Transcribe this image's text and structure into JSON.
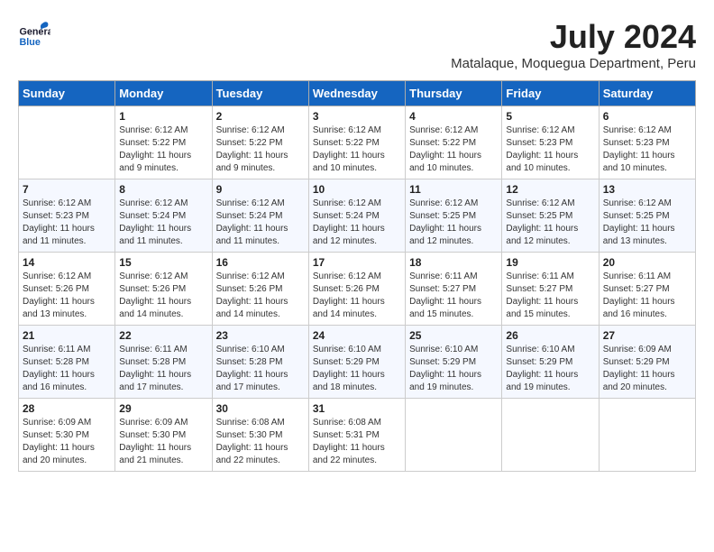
{
  "header": {
    "logo_general": "General",
    "logo_blue": "Blue",
    "month_year": "July 2024",
    "location": "Matalaque, Moquegua Department, Peru"
  },
  "weekdays": [
    "Sunday",
    "Monday",
    "Tuesday",
    "Wednesday",
    "Thursday",
    "Friday",
    "Saturday"
  ],
  "weeks": [
    [
      {
        "day": "",
        "info": ""
      },
      {
        "day": "1",
        "info": "Sunrise: 6:12 AM\nSunset: 5:22 PM\nDaylight: 11 hours\nand 9 minutes."
      },
      {
        "day": "2",
        "info": "Sunrise: 6:12 AM\nSunset: 5:22 PM\nDaylight: 11 hours\nand 9 minutes."
      },
      {
        "day": "3",
        "info": "Sunrise: 6:12 AM\nSunset: 5:22 PM\nDaylight: 11 hours\nand 10 minutes."
      },
      {
        "day": "4",
        "info": "Sunrise: 6:12 AM\nSunset: 5:22 PM\nDaylight: 11 hours\nand 10 minutes."
      },
      {
        "day": "5",
        "info": "Sunrise: 6:12 AM\nSunset: 5:23 PM\nDaylight: 11 hours\nand 10 minutes."
      },
      {
        "day": "6",
        "info": "Sunrise: 6:12 AM\nSunset: 5:23 PM\nDaylight: 11 hours\nand 10 minutes."
      }
    ],
    [
      {
        "day": "7",
        "info": "Sunrise: 6:12 AM\nSunset: 5:23 PM\nDaylight: 11 hours\nand 11 minutes."
      },
      {
        "day": "8",
        "info": "Sunrise: 6:12 AM\nSunset: 5:24 PM\nDaylight: 11 hours\nand 11 minutes."
      },
      {
        "day": "9",
        "info": "Sunrise: 6:12 AM\nSunset: 5:24 PM\nDaylight: 11 hours\nand 11 minutes."
      },
      {
        "day": "10",
        "info": "Sunrise: 6:12 AM\nSunset: 5:24 PM\nDaylight: 11 hours\nand 12 minutes."
      },
      {
        "day": "11",
        "info": "Sunrise: 6:12 AM\nSunset: 5:25 PM\nDaylight: 11 hours\nand 12 minutes."
      },
      {
        "day": "12",
        "info": "Sunrise: 6:12 AM\nSunset: 5:25 PM\nDaylight: 11 hours\nand 12 minutes."
      },
      {
        "day": "13",
        "info": "Sunrise: 6:12 AM\nSunset: 5:25 PM\nDaylight: 11 hours\nand 13 minutes."
      }
    ],
    [
      {
        "day": "14",
        "info": "Sunrise: 6:12 AM\nSunset: 5:26 PM\nDaylight: 11 hours\nand 13 minutes."
      },
      {
        "day": "15",
        "info": "Sunrise: 6:12 AM\nSunset: 5:26 PM\nDaylight: 11 hours\nand 14 minutes."
      },
      {
        "day": "16",
        "info": "Sunrise: 6:12 AM\nSunset: 5:26 PM\nDaylight: 11 hours\nand 14 minutes."
      },
      {
        "day": "17",
        "info": "Sunrise: 6:12 AM\nSunset: 5:26 PM\nDaylight: 11 hours\nand 14 minutes."
      },
      {
        "day": "18",
        "info": "Sunrise: 6:11 AM\nSunset: 5:27 PM\nDaylight: 11 hours\nand 15 minutes."
      },
      {
        "day": "19",
        "info": "Sunrise: 6:11 AM\nSunset: 5:27 PM\nDaylight: 11 hours\nand 15 minutes."
      },
      {
        "day": "20",
        "info": "Sunrise: 6:11 AM\nSunset: 5:27 PM\nDaylight: 11 hours\nand 16 minutes."
      }
    ],
    [
      {
        "day": "21",
        "info": "Sunrise: 6:11 AM\nSunset: 5:28 PM\nDaylight: 11 hours\nand 16 minutes."
      },
      {
        "day": "22",
        "info": "Sunrise: 6:11 AM\nSunset: 5:28 PM\nDaylight: 11 hours\nand 17 minutes."
      },
      {
        "day": "23",
        "info": "Sunrise: 6:10 AM\nSunset: 5:28 PM\nDaylight: 11 hours\nand 17 minutes."
      },
      {
        "day": "24",
        "info": "Sunrise: 6:10 AM\nSunset: 5:29 PM\nDaylight: 11 hours\nand 18 minutes."
      },
      {
        "day": "25",
        "info": "Sunrise: 6:10 AM\nSunset: 5:29 PM\nDaylight: 11 hours\nand 19 minutes."
      },
      {
        "day": "26",
        "info": "Sunrise: 6:10 AM\nSunset: 5:29 PM\nDaylight: 11 hours\nand 19 minutes."
      },
      {
        "day": "27",
        "info": "Sunrise: 6:09 AM\nSunset: 5:29 PM\nDaylight: 11 hours\nand 20 minutes."
      }
    ],
    [
      {
        "day": "28",
        "info": "Sunrise: 6:09 AM\nSunset: 5:30 PM\nDaylight: 11 hours\nand 20 minutes."
      },
      {
        "day": "29",
        "info": "Sunrise: 6:09 AM\nSunset: 5:30 PM\nDaylight: 11 hours\nand 21 minutes."
      },
      {
        "day": "30",
        "info": "Sunrise: 6:08 AM\nSunset: 5:30 PM\nDaylight: 11 hours\nand 22 minutes."
      },
      {
        "day": "31",
        "info": "Sunrise: 6:08 AM\nSunset: 5:31 PM\nDaylight: 11 hours\nand 22 minutes."
      },
      {
        "day": "",
        "info": ""
      },
      {
        "day": "",
        "info": ""
      },
      {
        "day": "",
        "info": ""
      }
    ]
  ]
}
